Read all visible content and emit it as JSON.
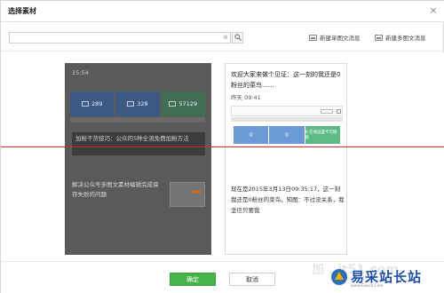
{
  "dialog": {
    "title": "选择素材",
    "close": "×"
  },
  "toolbar": {
    "search_placeholder": "",
    "search_clear": "⊗",
    "search_icon": "search-icon",
    "new_single_label": "新建单图文消息",
    "new_multi_label": "新建多图文消息"
  },
  "card_left": {
    "time": "15:54",
    "stats": [
      "289",
      "328",
      "57129"
    ],
    "headline": "加粉干货技巧：公众的5种全流免费加粉方法",
    "item2_title": "解决公众号多图文素材编辑完成保存失败的问题"
  },
  "card_right": {
    "title": "欢迎大家来做个见证：这一刻的我还是0粉丝的菜鸟……",
    "time": "昨天 09:41",
    "stats": [
      "0",
      "0",
      "0"
    ],
    "stat3_label": "0 在线设置不可搜索",
    "body": "现在是2015年3月13日09:35:17，这一刻我还是0粉丝的菜鸟，知图：不过没关系，我坚信只要我"
  },
  "footer": {
    "ok_label": "确定",
    "cancel_label": "取消"
  },
  "watermark": {
    "faint": "加 . it51.com",
    "brand": "易采站长站",
    "sub": "www.Easck.Com"
  },
  "colors": {
    "ok": "#44b549",
    "stat_blue": "#6b9ad7",
    "stat_green": "#5cbb85",
    "redline": "#d12a2a"
  }
}
